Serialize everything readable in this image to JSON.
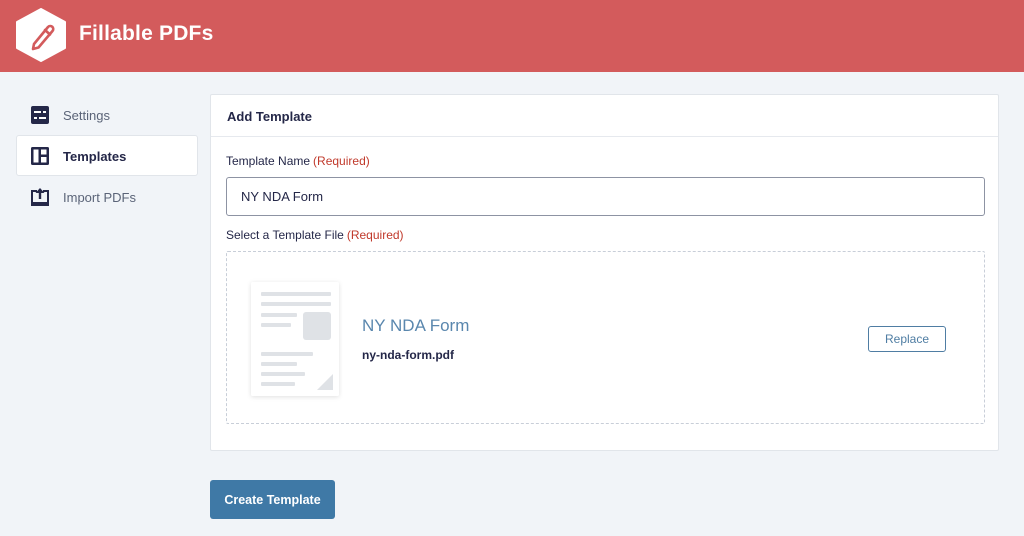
{
  "app": {
    "title": "Fillable PDFs",
    "logo_icon": "pen-icon",
    "brand_color": "#d35b5c"
  },
  "sidebar": {
    "items": [
      {
        "label": "Settings",
        "icon": "settings-icon",
        "active": false
      },
      {
        "label": "Templates",
        "icon": "templates-icon",
        "active": true
      },
      {
        "label": "Import PDFs",
        "icon": "import-icon",
        "active": false
      }
    ]
  },
  "card": {
    "title": "Add Template",
    "name_field": {
      "label": "Template Name",
      "required": "(Required)",
      "value": "NY NDA Form"
    },
    "file_field": {
      "label": "Select a Template File",
      "required": "(Required)",
      "file_title": "NY NDA Form",
      "file_name": "ny-nda-form.pdf",
      "replace_label": "Replace"
    }
  },
  "actions": {
    "create_label": "Create Template",
    "accent_color": "#3f79a6"
  }
}
